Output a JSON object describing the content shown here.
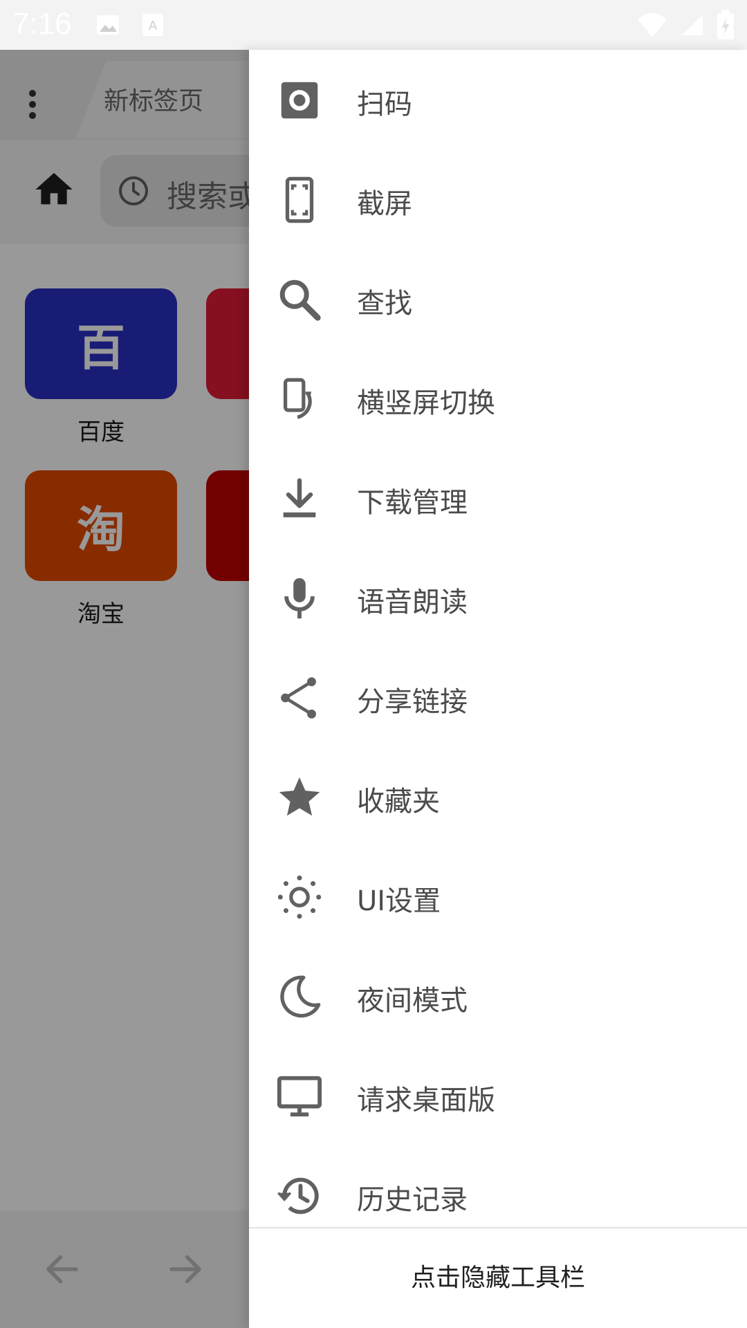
{
  "status_bar": {
    "time": "7:16"
  },
  "browser": {
    "tab_title": "新标签页",
    "search_placeholder": "搜索或",
    "shortcuts": [
      {
        "glyph": "百",
        "label": "百度",
        "color": "#2a2fc4"
      },
      {
        "glyph": "淘",
        "label": "淘宝",
        "color": "#e34a00"
      }
    ]
  },
  "drawer": {
    "items": [
      {
        "label": "扫码",
        "icon": "scan-icon"
      },
      {
        "label": "截屏",
        "icon": "screenshot-icon"
      },
      {
        "label": "查找",
        "icon": "search-icon"
      },
      {
        "label": "横竖屏切换",
        "icon": "rotate-screen-icon"
      },
      {
        "label": "下载管理",
        "icon": "download-icon"
      },
      {
        "label": "语音朗读",
        "icon": "microphone-icon"
      },
      {
        "label": "分享链接",
        "icon": "share-icon"
      },
      {
        "label": "收藏夹",
        "icon": "star-icon"
      },
      {
        "label": "UI设置",
        "icon": "brightness-icon"
      },
      {
        "label": "夜间模式",
        "icon": "moon-icon"
      },
      {
        "label": "请求桌面版",
        "icon": "desktop-icon"
      },
      {
        "label": "历史记录",
        "icon": "history-icon"
      }
    ],
    "hide_toolbar_label": "点击隐藏工具栏"
  },
  "colors": {
    "icon_gray": "#616161",
    "drawer_bg": "#ffffff",
    "scrim": "#7a7a7a"
  }
}
